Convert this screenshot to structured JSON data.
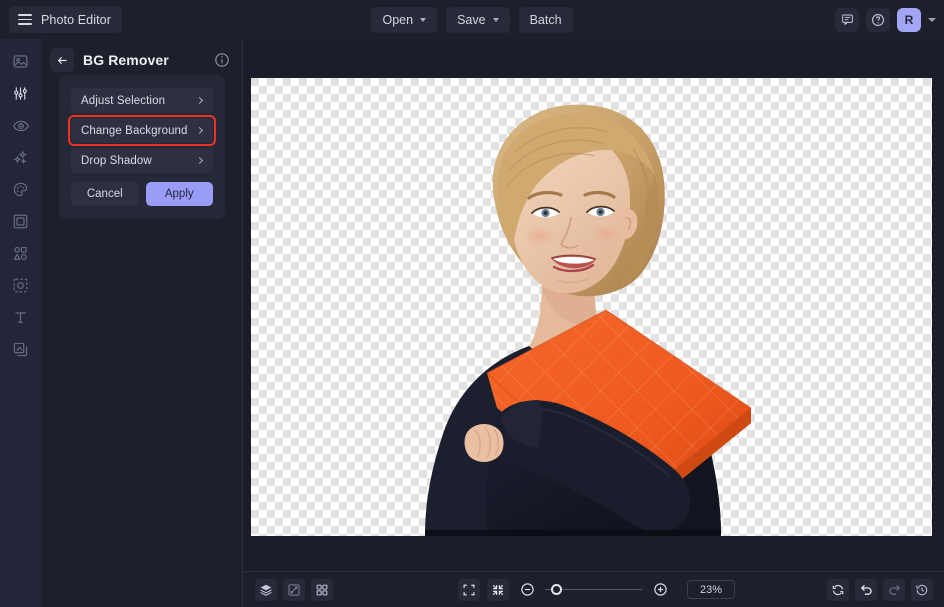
{
  "app": {
    "title": "Photo Editor",
    "menu_icon": "hamburger-icon",
    "background": "#1b1d2a",
    "accent": "#9a9cf7",
    "annotation_color": "#ef3124"
  },
  "topbar": {
    "open_label": "Open",
    "save_label": "Save",
    "batch_label": "Batch",
    "comment_icon": "comment-icon",
    "help_icon": "help-circle-icon",
    "avatar_initial": "R",
    "avatar_caret_icon": "chevron-down-icon"
  },
  "rail": {
    "items": [
      {
        "name": "image-icon",
        "label": "Image"
      },
      {
        "name": "adjustments-icon",
        "label": "Adjust"
      },
      {
        "name": "eye-icon",
        "label": "Preview"
      },
      {
        "name": "sparkles-icon",
        "label": "Effects"
      },
      {
        "name": "palette-icon",
        "label": "Color"
      },
      {
        "name": "frame-icon",
        "label": "Frame"
      },
      {
        "name": "shapes-icon",
        "label": "Shapes"
      },
      {
        "name": "bg-remover-icon",
        "label": "BG Remover"
      },
      {
        "name": "text-icon",
        "label": "Text"
      },
      {
        "name": "layers-icon",
        "label": "Layers"
      }
    ]
  },
  "panel": {
    "back_icon": "arrow-left-icon",
    "title": "BG Remover",
    "info_icon": "info-circle-icon",
    "rows": [
      {
        "label": "Adjust Selection",
        "highlighted": false
      },
      {
        "label": "Change Background",
        "highlighted": true
      },
      {
        "label": "Drop Shadow",
        "highlighted": false
      }
    ],
    "cancel_label": "Cancel",
    "apply_label": "Apply"
  },
  "canvas": {
    "transparency": "checkerboard",
    "subject_description": "Smiling blonde woman in dark navy top holding an orange folder"
  },
  "bottombar": {
    "left_tools": [
      {
        "name": "layers-stack-icon",
        "label": "Layers"
      },
      {
        "name": "transform-icon",
        "label": "Transform"
      },
      {
        "name": "grid-icon",
        "label": "Grid"
      }
    ],
    "view_tools": [
      {
        "name": "fit-screen-icon",
        "label": "Fit to screen"
      },
      {
        "name": "shrink-icon",
        "label": "Actual size"
      }
    ],
    "zoom_out_icon": "minus-circle-icon",
    "zoom_in_icon": "plus-circle-icon",
    "zoom_value": "23%",
    "right_tools": [
      {
        "name": "reset-icon",
        "label": "Reset"
      },
      {
        "name": "undo-icon",
        "label": "Undo"
      },
      {
        "name": "redo-icon",
        "label": "Redo"
      },
      {
        "name": "history-icon",
        "label": "History"
      }
    ]
  }
}
